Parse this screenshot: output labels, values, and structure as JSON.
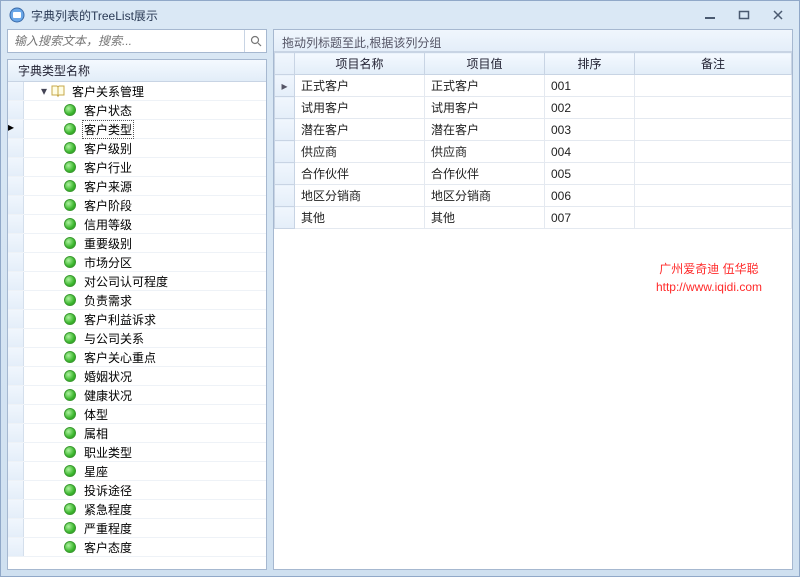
{
  "window": {
    "title": "字典列表的TreeList展示"
  },
  "search": {
    "placeholder": "输入搜索文本，搜索..."
  },
  "tree": {
    "header": "字典类型名称",
    "root": "客户关系管理",
    "items": [
      "客户状态",
      "客户类型",
      "客户级别",
      "客户行业",
      "客户来源",
      "客户阶段",
      "信用等级",
      "重要级别",
      "市场分区",
      "对公司认可程度",
      "负责需求",
      "客户利益诉求",
      "与公司关系",
      "客户关心重点",
      "婚姻状况",
      "健康状况",
      "体型",
      "属相",
      "职业类型",
      "星座",
      "投诉途径",
      "紧急程度",
      "严重程度",
      "客户态度"
    ],
    "selected_index": 1
  },
  "grid": {
    "group_hint": "拖动列标题至此,根据该列分组",
    "columns": [
      "项目名称",
      "项目值",
      "排序",
      "备注"
    ],
    "rows": [
      {
        "name": "正式客户",
        "value": "正式客户",
        "sort": "001",
        "remark": ""
      },
      {
        "name": "试用客户",
        "value": "试用客户",
        "sort": "002",
        "remark": ""
      },
      {
        "name": "潜在客户",
        "value": "潜在客户",
        "sort": "003",
        "remark": ""
      },
      {
        "name": "供应商",
        "value": "供应商",
        "sort": "004",
        "remark": ""
      },
      {
        "name": "合作伙伴",
        "value": "合作伙伴",
        "sort": "005",
        "remark": ""
      },
      {
        "name": "地区分销商",
        "value": "地区分销商",
        "sort": "006",
        "remark": ""
      },
      {
        "name": "其他",
        "value": "其他",
        "sort": "007",
        "remark": ""
      }
    ],
    "current_row": 0
  },
  "watermark": {
    "line1": "广州爱奇迪 伍华聪",
    "line2": "http://www.iqidi.com"
  }
}
